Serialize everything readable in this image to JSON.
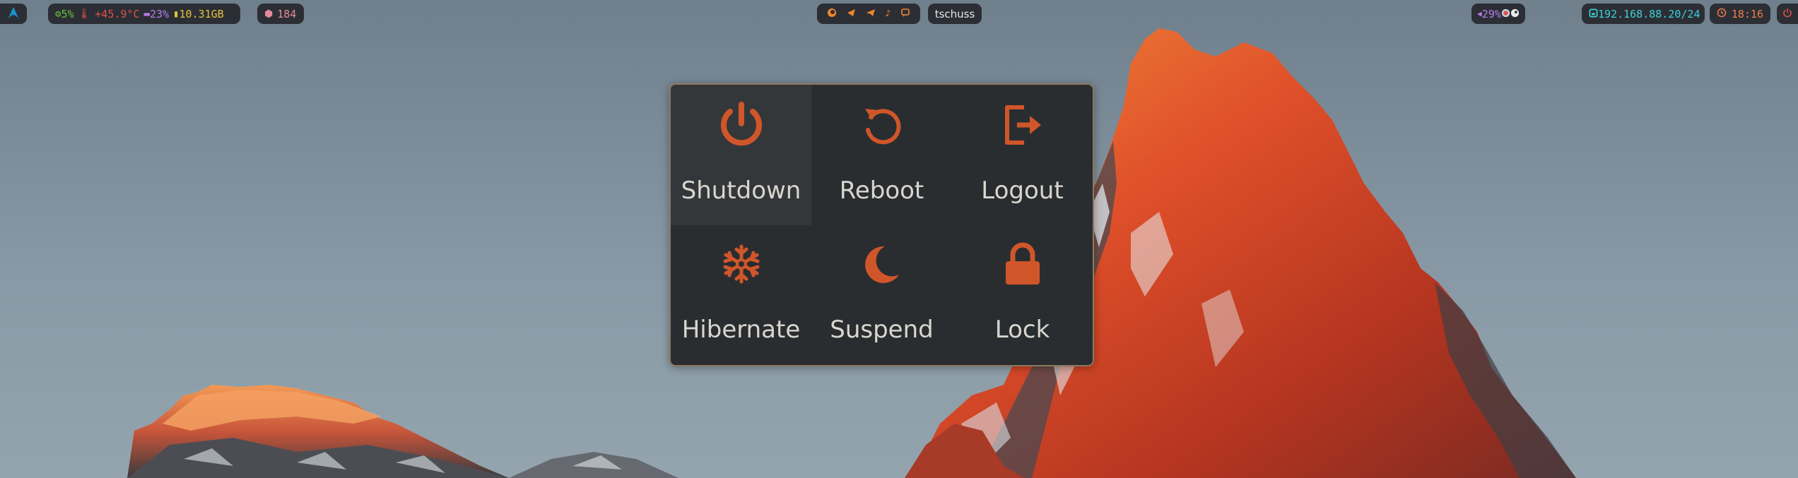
{
  "colors": {
    "bar_bg": "#2b2f35",
    "menu_bg": "#2a2d30",
    "menu_border": "#8b7a60",
    "icon_orange": "#d0562a",
    "label_text": "#d9d6cf",
    "green": "#67c23a",
    "red": "#e0504a",
    "purple": "#b77cf0",
    "yellow": "#e5c23c",
    "pink": "#e58a9a",
    "teal": "#3cd0d6",
    "orange": "#f0862e"
  },
  "bar": {
    "launcher_icon": "arch-logo-icon",
    "system": {
      "cpu_icon": "cpu-icon",
      "cpu": "5%",
      "temp_icon": "thermometer-icon",
      "temp": "+45.9°C",
      "memory_icon": "memory-icon",
      "memory": "23%",
      "disk_icon": "disk-icon",
      "disk": "10.31GB"
    },
    "updates": {
      "icon": "package-icon",
      "count": "184"
    },
    "tray_apps": [
      "firefox-icon",
      "terminal-icon",
      "telegram-icon",
      "music-icon",
      "chat-icon"
    ],
    "workspace": "tschuss",
    "audio": {
      "icon": "volume-icon",
      "volume": "29%",
      "app_icons": [
        "record-icon",
        "steam-icon"
      ]
    },
    "network": {
      "icon": "ethernet-icon",
      "address": "192.168.88.20/24"
    },
    "clock": {
      "icon": "clock-icon",
      "time": "18:16"
    },
    "power_icon": "power-icon"
  },
  "power_menu": {
    "items": [
      {
        "label": "Shutdown",
        "icon": "power-icon"
      },
      {
        "label": "Reboot",
        "icon": "restart-icon"
      },
      {
        "label": "Logout",
        "icon": "logout-icon"
      },
      {
        "label": "Hibernate",
        "icon": "snowflake-icon"
      },
      {
        "label": "Suspend",
        "icon": "moon-icon"
      },
      {
        "label": "Lock",
        "icon": "lock-icon"
      }
    ]
  }
}
